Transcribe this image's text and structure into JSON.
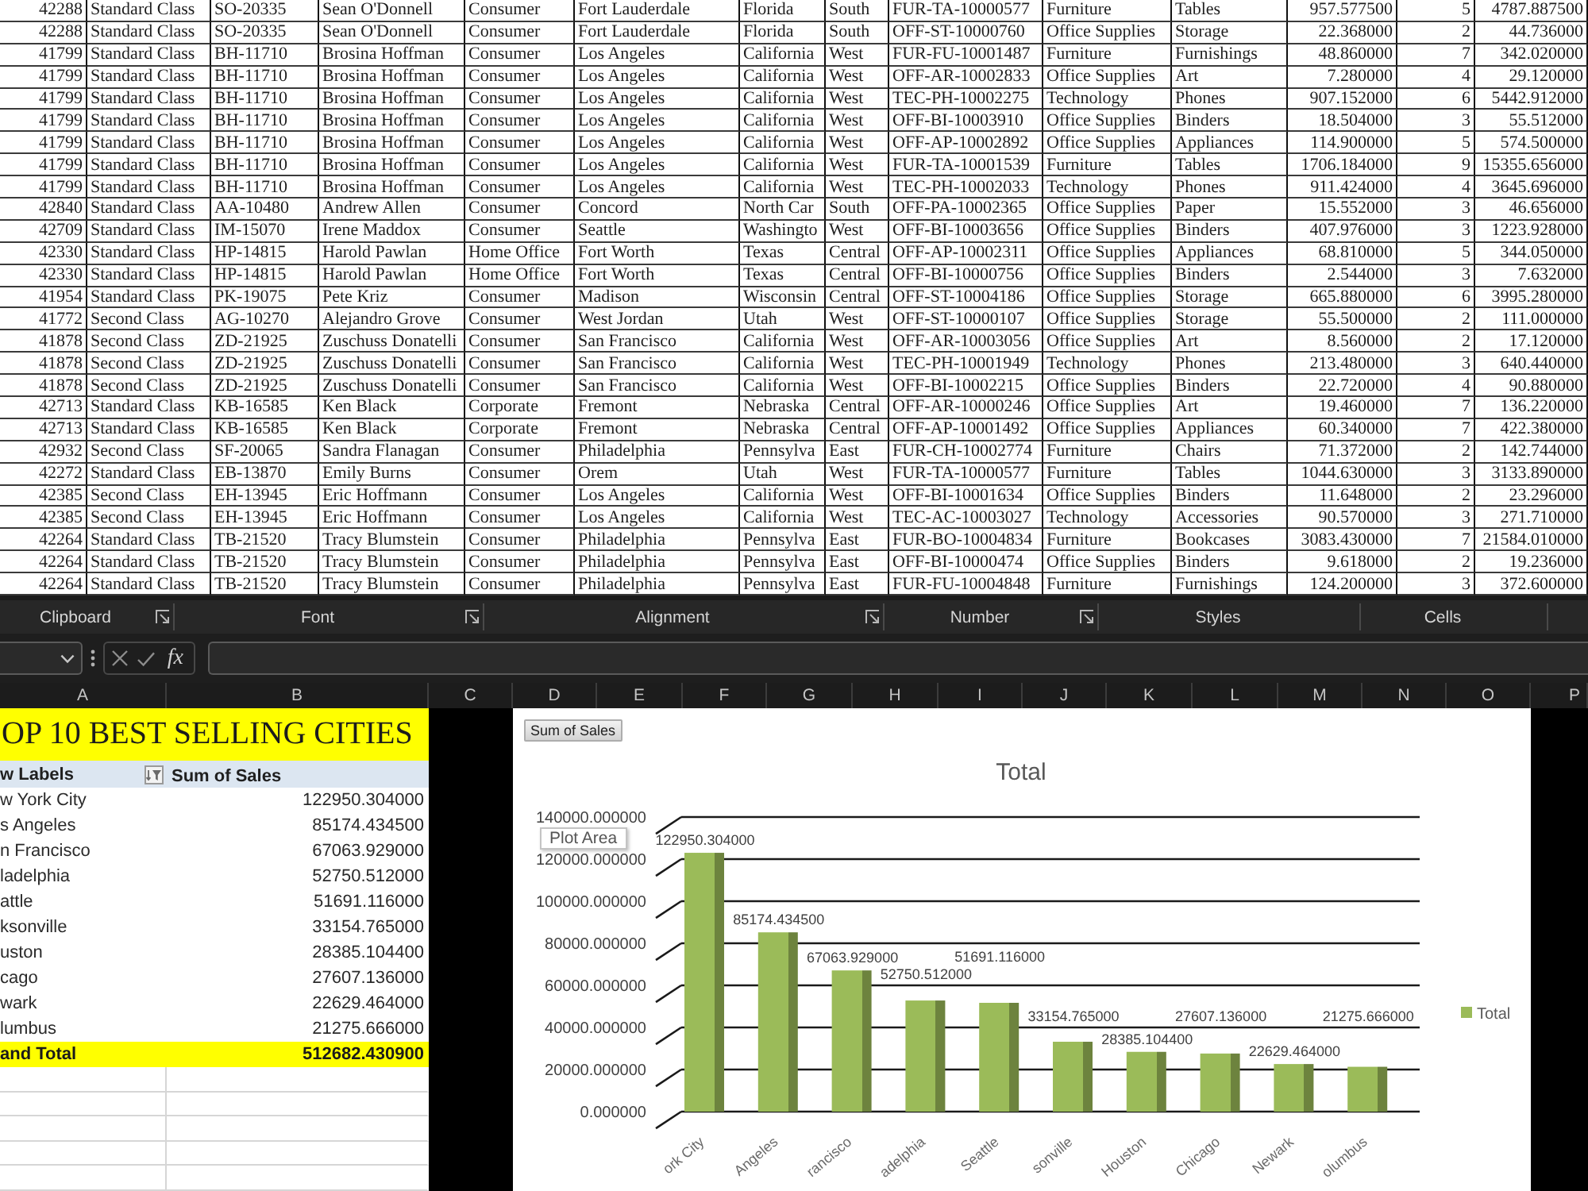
{
  "data_table": {
    "rows": [
      [
        "42288",
        "Standard Class",
        "SO-20335",
        "Sean O'Donnell",
        "Consumer",
        "Fort Lauderdale",
        "Florida",
        "South",
        "FUR-TA-10000577",
        "Furniture",
        "Tables",
        "957.577500",
        "5",
        "4787.887500"
      ],
      [
        "42288",
        "Standard Class",
        "SO-20335",
        "Sean O'Donnell",
        "Consumer",
        "Fort Lauderdale",
        "Florida",
        "South",
        "OFF-ST-10000760",
        "Office Supplies",
        "Storage",
        "22.368000",
        "2",
        "44.736000"
      ],
      [
        "41799",
        "Standard Class",
        "BH-11710",
        "Brosina Hoffman",
        "Consumer",
        "Los Angeles",
        "California",
        "West",
        "FUR-FU-10001487",
        "Furniture",
        "Furnishings",
        "48.860000",
        "7",
        "342.020000"
      ],
      [
        "41799",
        "Standard Class",
        "BH-11710",
        "Brosina Hoffman",
        "Consumer",
        "Los Angeles",
        "California",
        "West",
        "OFF-AR-10002833",
        "Office Supplies",
        "Art",
        "7.280000",
        "4",
        "29.120000"
      ],
      [
        "41799",
        "Standard Class",
        "BH-11710",
        "Brosina Hoffman",
        "Consumer",
        "Los Angeles",
        "California",
        "West",
        "TEC-PH-10002275",
        "Technology",
        "Phones",
        "907.152000",
        "6",
        "5442.912000"
      ],
      [
        "41799",
        "Standard Class",
        "BH-11710",
        "Brosina Hoffman",
        "Consumer",
        "Los Angeles",
        "California",
        "West",
        "OFF-BI-10003910",
        "Office Supplies",
        "Binders",
        "18.504000",
        "3",
        "55.512000"
      ],
      [
        "41799",
        "Standard Class",
        "BH-11710",
        "Brosina Hoffman",
        "Consumer",
        "Los Angeles",
        "California",
        "West",
        "OFF-AP-10002892",
        "Office Supplies",
        "Appliances",
        "114.900000",
        "5",
        "574.500000"
      ],
      [
        "41799",
        "Standard Class",
        "BH-11710",
        "Brosina Hoffman",
        "Consumer",
        "Los Angeles",
        "California",
        "West",
        "FUR-TA-10001539",
        "Furniture",
        "Tables",
        "1706.184000",
        "9",
        "15355.656000"
      ],
      [
        "41799",
        "Standard Class",
        "BH-11710",
        "Brosina Hoffman",
        "Consumer",
        "Los Angeles",
        "California",
        "West",
        "TEC-PH-10002033",
        "Technology",
        "Phones",
        "911.424000",
        "4",
        "3645.696000"
      ],
      [
        "42840",
        "Standard Class",
        "AA-10480",
        "Andrew Allen",
        "Consumer",
        "Concord",
        "North Car",
        "South",
        "OFF-PA-10002365",
        "Office Supplies",
        "Paper",
        "15.552000",
        "3",
        "46.656000"
      ],
      [
        "42709",
        "Standard Class",
        "IM-15070",
        "Irene Maddox",
        "Consumer",
        "Seattle",
        "Washingto",
        "West",
        "OFF-BI-10003656",
        "Office Supplies",
        "Binders",
        "407.976000",
        "3",
        "1223.928000"
      ],
      [
        "42330",
        "Standard Class",
        "HP-14815",
        "Harold Pawlan",
        "Home Office",
        "Fort Worth",
        "Texas",
        "Central",
        "OFF-AP-10002311",
        "Office Supplies",
        "Appliances",
        "68.810000",
        "5",
        "344.050000"
      ],
      [
        "42330",
        "Standard Class",
        "HP-14815",
        "Harold Pawlan",
        "Home Office",
        "Fort Worth",
        "Texas",
        "Central",
        "OFF-BI-10000756",
        "Office Supplies",
        "Binders",
        "2.544000",
        "3",
        "7.632000"
      ],
      [
        "41954",
        "Standard Class",
        "PK-19075",
        "Pete Kriz",
        "Consumer",
        "Madison",
        "Wisconsin",
        "Central",
        "OFF-ST-10004186",
        "Office Supplies",
        "Storage",
        "665.880000",
        "6",
        "3995.280000"
      ],
      [
        "41772",
        "Second Class",
        "AG-10270",
        "Alejandro Grove",
        "Consumer",
        "West Jordan",
        "Utah",
        "West",
        "OFF-ST-10000107",
        "Office Supplies",
        "Storage",
        "55.500000",
        "2",
        "111.000000"
      ],
      [
        "41878",
        "Second Class",
        "ZD-21925",
        "Zuschuss Donatelli",
        "Consumer",
        "San Francisco",
        "California",
        "West",
        "OFF-AR-10003056",
        "Office Supplies",
        "Art",
        "8.560000",
        "2",
        "17.120000"
      ],
      [
        "41878",
        "Second Class",
        "ZD-21925",
        "Zuschuss Donatelli",
        "Consumer",
        "San Francisco",
        "California",
        "West",
        "TEC-PH-10001949",
        "Technology",
        "Phones",
        "213.480000",
        "3",
        "640.440000"
      ],
      [
        "41878",
        "Second Class",
        "ZD-21925",
        "Zuschuss Donatelli",
        "Consumer",
        "San Francisco",
        "California",
        "West",
        "OFF-BI-10002215",
        "Office Supplies",
        "Binders",
        "22.720000",
        "4",
        "90.880000"
      ],
      [
        "42713",
        "Standard Class",
        "KB-16585",
        "Ken Black",
        "Corporate",
        "Fremont",
        "Nebraska",
        "Central",
        "OFF-AR-10000246",
        "Office Supplies",
        "Art",
        "19.460000",
        "7",
        "136.220000"
      ],
      [
        "42713",
        "Standard Class",
        "KB-16585",
        "Ken Black",
        "Corporate",
        "Fremont",
        "Nebraska",
        "Central",
        "OFF-AP-10001492",
        "Office Supplies",
        "Appliances",
        "60.340000",
        "7",
        "422.380000"
      ],
      [
        "42932",
        "Second Class",
        "SF-20065",
        "Sandra Flanagan",
        "Consumer",
        "Philadelphia",
        "Pennsylva",
        "East",
        "FUR-CH-10002774",
        "Furniture",
        "Chairs",
        "71.372000",
        "2",
        "142.744000"
      ],
      [
        "42272",
        "Standard Class",
        "EB-13870",
        "Emily Burns",
        "Consumer",
        "Orem",
        "Utah",
        "West",
        "FUR-TA-10000577",
        "Furniture",
        "Tables",
        "1044.630000",
        "3",
        "3133.890000"
      ],
      [
        "42385",
        "Second Class",
        "EH-13945",
        "Eric Hoffmann",
        "Consumer",
        "Los Angeles",
        "California",
        "West",
        "OFF-BI-10001634",
        "Office Supplies",
        "Binders",
        "11.648000",
        "2",
        "23.296000"
      ],
      [
        "42385",
        "Second Class",
        "EH-13945",
        "Eric Hoffmann",
        "Consumer",
        "Los Angeles",
        "California",
        "West",
        "TEC-AC-10003027",
        "Technology",
        "Accessories",
        "90.570000",
        "3",
        "271.710000"
      ],
      [
        "42264",
        "Standard Class",
        "TB-21520",
        "Tracy Blumstein",
        "Consumer",
        "Philadelphia",
        "Pennsylva",
        "East",
        "FUR-BO-10004834",
        "Furniture",
        "Bookcases",
        "3083.430000",
        "7",
        "21584.010000"
      ],
      [
        "42264",
        "Standard Class",
        "TB-21520",
        "Tracy Blumstein",
        "Consumer",
        "Philadelphia",
        "Pennsylva",
        "East",
        "OFF-BI-10000474",
        "Office Supplies",
        "Binders",
        "9.618000",
        "2",
        "19.236000"
      ],
      [
        "42264",
        "Standard Class",
        "TB-21520",
        "Tracy Blumstein",
        "Consumer",
        "Philadelphia",
        "Pennsylva",
        "East",
        "FUR-FU-10004848",
        "Furniture",
        "Furnishings",
        "124.200000",
        "3",
        "372.600000"
      ]
    ]
  },
  "ribbon": {
    "groups": [
      {
        "label": "Clipboard",
        "launcher": true
      },
      {
        "label": "Font",
        "launcher": true
      },
      {
        "label": "Alignment",
        "launcher": true
      },
      {
        "label": "Number",
        "launcher": true
      },
      {
        "label": "Styles",
        "launcher": false
      },
      {
        "label": "Cells",
        "launcher": false
      }
    ]
  },
  "formula_bar": {
    "function_label": "fx"
  },
  "column_headers": [
    "A",
    "B",
    "C",
    "D",
    "E",
    "F",
    "G",
    "H",
    "I",
    "J",
    "K",
    "L",
    "M",
    "N",
    "O",
    "P"
  ],
  "pivot_table": {
    "title": "OP 10 BEST SELLING CITIES",
    "row_labels_header": "w Labels",
    "row_labels_filtered": true,
    "value_header": "Sum of Sales",
    "rows": [
      {
        "label": "w York City",
        "value": "122950.304000"
      },
      {
        "label": "s Angeles",
        "value": "85174.434500"
      },
      {
        "label": "n Francisco",
        "value": "67063.929000"
      },
      {
        "label": "ladelphia",
        "value": "52750.512000"
      },
      {
        "label": "attle",
        "value": "51691.116000"
      },
      {
        "label": "ksonville",
        "value": "33154.765000"
      },
      {
        "label": "uston",
        "value": "28385.104400"
      },
      {
        "label": "cago",
        "value": "27607.136000"
      },
      {
        "label": "wark",
        "value": "22629.464000"
      },
      {
        "label": "lumbus",
        "value": "21275.666000"
      }
    ],
    "grand_total": {
      "label": "and Total",
      "value": "512682.430900"
    }
  },
  "chart": {
    "field_button": "Sum of Sales",
    "tooltip": "Plot Area",
    "chart_data": {
      "type": "bar",
      "title": "Total",
      "categories": [
        "ork City",
        "Angeles",
        "rancisco",
        "adelphia",
        "Seattle",
        "sonville",
        "Houston",
        "Chicago",
        "Newark",
        "olumbus"
      ],
      "series": [
        {
          "name": "Total",
          "color": "#9bbb59",
          "values": [
            123000,
            85200,
            67100,
            52800,
            51700,
            33200,
            28400,
            27600,
            22600,
            21300
          ]
        }
      ],
      "ylim": [
        0,
        140000
      ],
      "yticks": [
        {
          "value": 0,
          "label": "0.000000"
        },
        {
          "value": 20000,
          "label": "20000.000000"
        },
        {
          "value": 40000,
          "label": "40000.000000"
        },
        {
          "value": 60000,
          "label": "60000.000000"
        },
        {
          "value": 80000,
          "label": "80000.000000"
        },
        {
          "value": 100000,
          "label": "100000.000000"
        },
        {
          "value": 120000,
          "label": "120000.000000"
        },
        {
          "value": 140000,
          "label": "140000.000000"
        }
      ],
      "grid": true,
      "value_labels": [
        "122950.304000",
        "85174.434500",
        "67063.929000",
        "52750.512000",
        "51691.116000",
        "33154.765000",
        "28385.104400",
        "27607.136000",
        "22629.464000",
        "21275.666000"
      ]
    }
  }
}
